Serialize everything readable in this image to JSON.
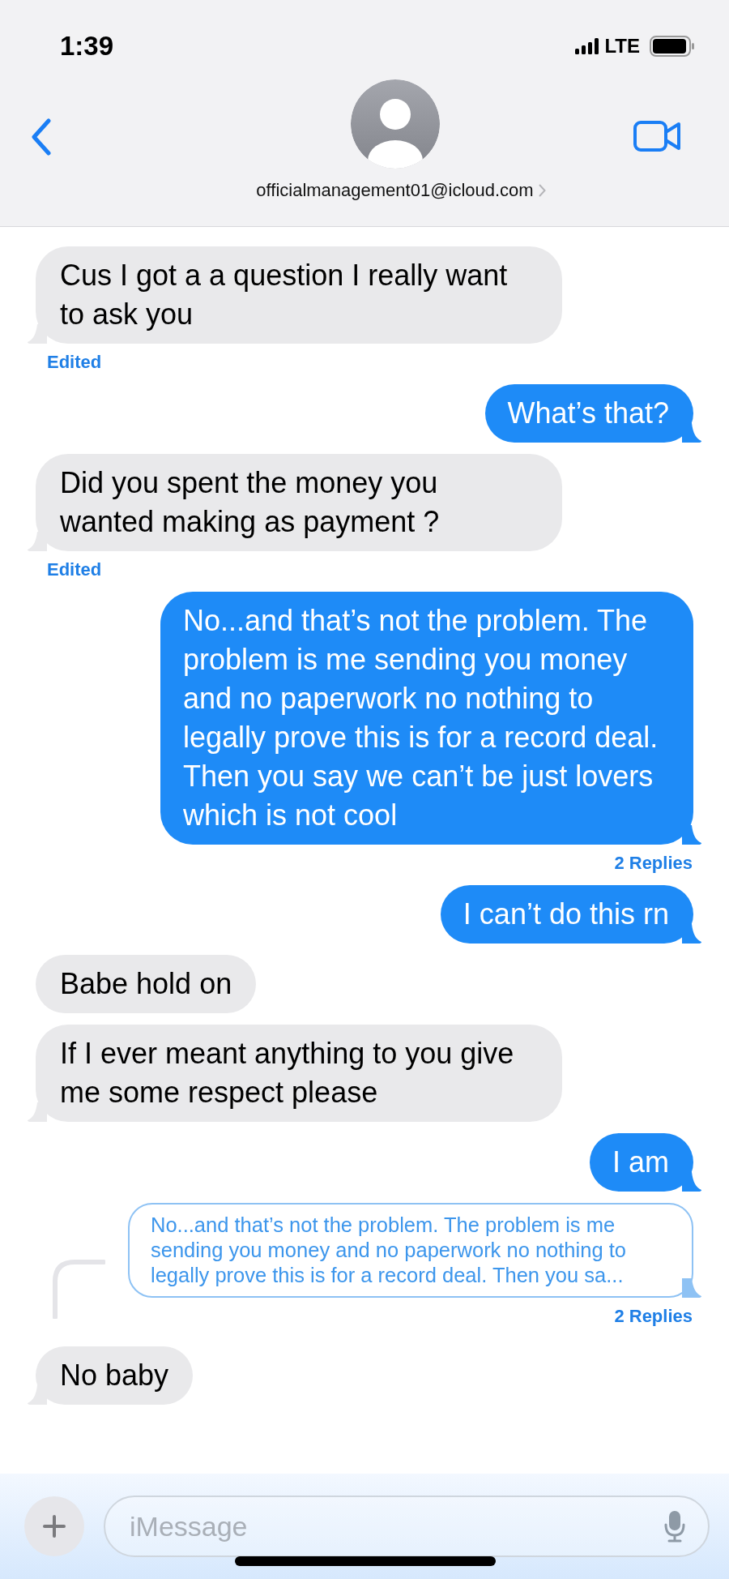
{
  "status_bar": {
    "time": "1:39",
    "network": "LTE"
  },
  "header": {
    "contact": "officialmanagement01@icloud.com"
  },
  "messages": [
    {
      "kind": "incoming",
      "text": "Cus I got a a question I really want to ask you",
      "tail": true,
      "edited": "Edited"
    },
    {
      "kind": "outgoing",
      "text": "What’s that?",
      "tail": true
    },
    {
      "kind": "incoming",
      "text": "Did you spent the money you wanted making as payment ?",
      "tail": true,
      "edited": "Edited"
    },
    {
      "kind": "outgoing",
      "text": "No...and that’s not the problem. The problem is me sending you money and no paperwork no nothing to legally prove this is for a record deal. Then you say we can’t be just lovers which is not cool",
      "tail": true,
      "replies": "2 Replies"
    },
    {
      "kind": "outgoing",
      "text": "I can’t do this rn",
      "tail": true
    },
    {
      "kind": "incoming",
      "text": "Babe hold on",
      "tail": false
    },
    {
      "kind": "incoming",
      "text": "If I ever meant anything to you give me some respect please",
      "tail": true
    },
    {
      "kind": "outgoing",
      "text": "I am",
      "tail": true
    },
    {
      "kind": "quote",
      "text": "No...and that’s not the problem. The problem is me sending you money and no paperwork no nothing to legally prove this is for a record deal. Then you sa...",
      "tail": true,
      "replies": "2 Replies"
    },
    {
      "kind": "incoming",
      "text": "No baby",
      "tail": true,
      "threaded": true
    }
  ],
  "composer": {
    "placeholder": "iMessage"
  }
}
